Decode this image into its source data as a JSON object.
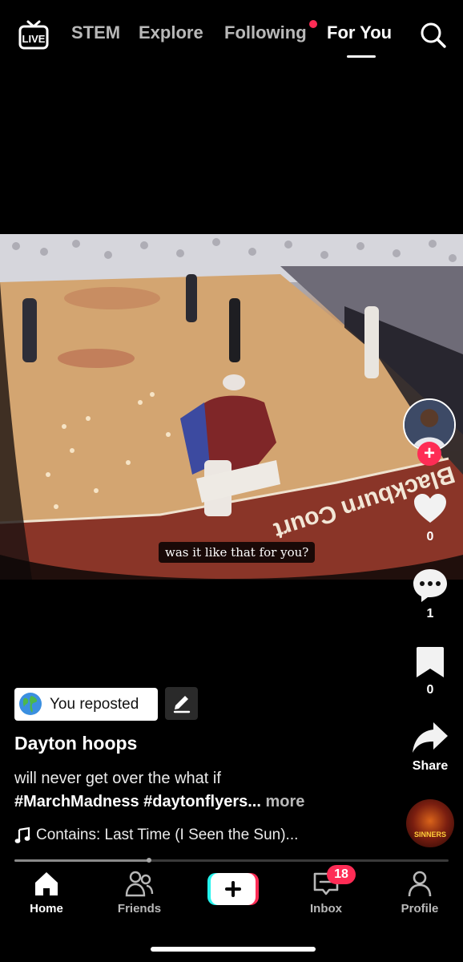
{
  "top_tabs": [
    {
      "label": "STEM"
    },
    {
      "label": "Explore"
    },
    {
      "label": "Following"
    },
    {
      "label": "For You"
    }
  ],
  "live_label": "LIVE",
  "video": {
    "caption": "was it like that for you?",
    "court_text": "Blackburn Court"
  },
  "actions": {
    "likes": "0",
    "comments": "1",
    "saves": "0",
    "share_label": "Share"
  },
  "repost": {
    "label": "You reposted"
  },
  "post": {
    "username": "Dayton hoops",
    "description": "will never get over the what if",
    "hashtags": "#MarchMadness #daytonflyers...",
    "more": "more",
    "music": "Contains: Last Time (I Seen the Sun)..."
  },
  "sound_disc_label": "SINNERS",
  "progress": 0.31,
  "bottom_nav": {
    "home": "Home",
    "friends": "Friends",
    "inbox": "Inbox",
    "profile": "Profile",
    "inbox_badge": "18"
  },
  "colors": {
    "accent": "#fe2c55",
    "create_left": "#25f4ee",
    "create_right": "#fe2c55"
  }
}
